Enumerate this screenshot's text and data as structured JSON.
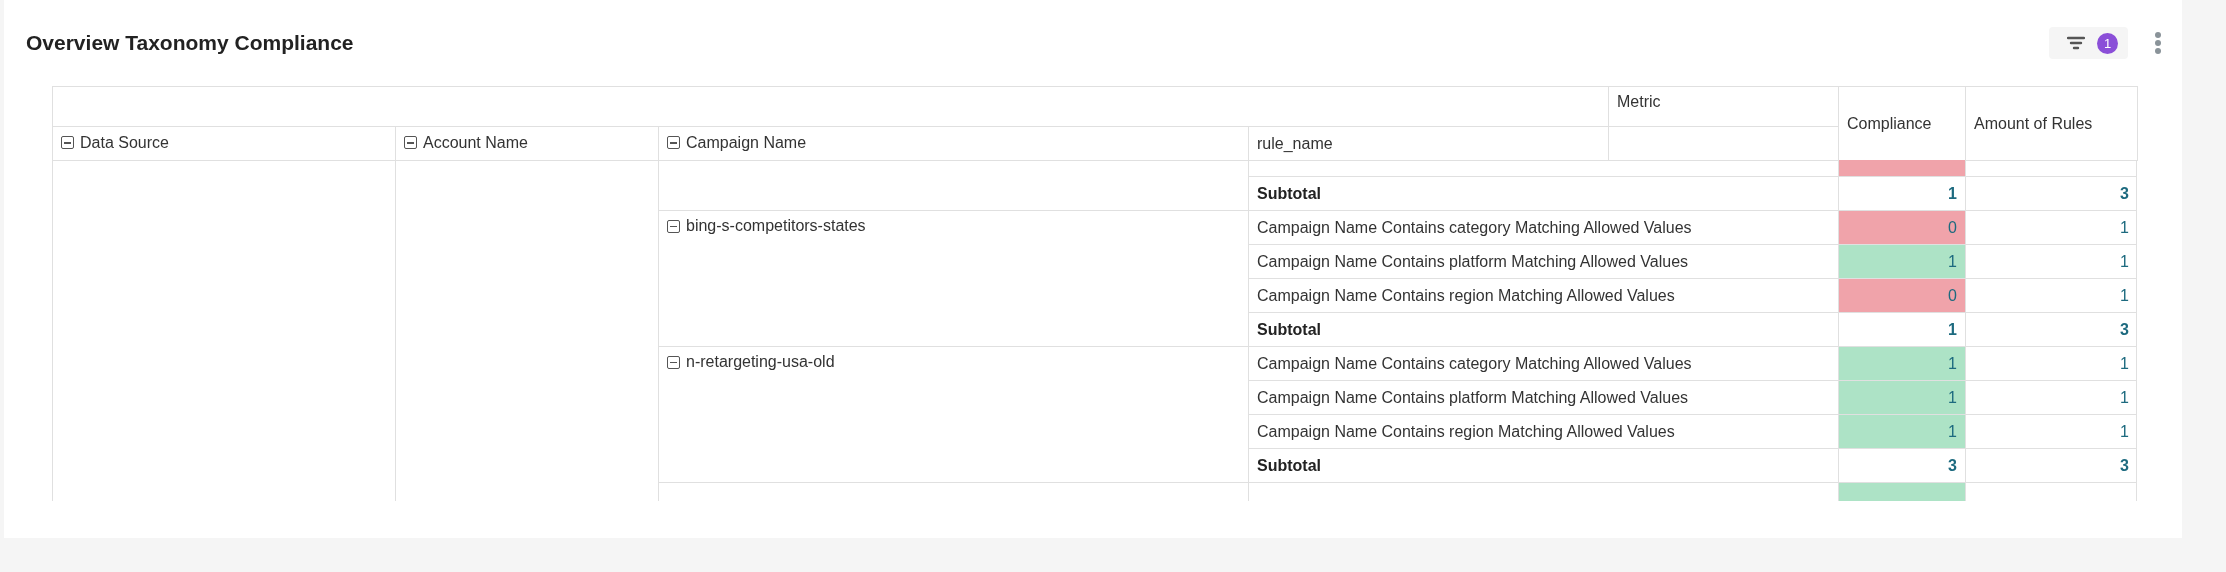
{
  "title": "Overview Taxonomy Compliance",
  "filter": {
    "badge": "1"
  },
  "table": {
    "header_top": "Metric",
    "columns": [
      "Data Source",
      "Account Name",
      "Campaign Name",
      "rule_name"
    ],
    "metric_columns": [
      "Compliance",
      "Amount of Rules"
    ],
    "groups": [
      {
        "rows": [
          {
            "compliant": false
          }
        ],
        "subtotal": {
          "label": "Subtotal",
          "compliance": "1",
          "amount": "3"
        }
      },
      {
        "campaign": "bing-s-competitors-states",
        "rows": [
          {
            "rule": "Campaign Name Contains category Matching Allowed Values",
            "compliance": "0",
            "compliant": false,
            "amount": "1"
          },
          {
            "rule": "Campaign Name Contains platform Matching Allowed Values",
            "compliance": "1",
            "compliant": true,
            "amount": "1"
          },
          {
            "rule": "Campaign Name Contains region Matching Allowed Values",
            "compliance": "0",
            "compliant": false,
            "amount": "1"
          }
        ],
        "subtotal": {
          "label": "Subtotal",
          "compliance": "1",
          "amount": "3"
        }
      },
      {
        "campaign": "n-retargeting-usa-old",
        "rows": [
          {
            "rule": "Campaign Name Contains category Matching Allowed Values",
            "compliance": "1",
            "compliant": true,
            "amount": "1"
          },
          {
            "rule": "Campaign Name Contains platform Matching Allowed Values",
            "compliance": "1",
            "compliant": true,
            "amount": "1"
          },
          {
            "rule": "Campaign Name Contains region Matching Allowed Values",
            "compliance": "1",
            "compliant": true,
            "amount": "1"
          }
        ],
        "subtotal": {
          "label": "Subtotal",
          "compliance": "3",
          "amount": "3"
        }
      },
      {
        "rows": [
          {
            "compliant": true
          }
        ]
      }
    ]
  }
}
